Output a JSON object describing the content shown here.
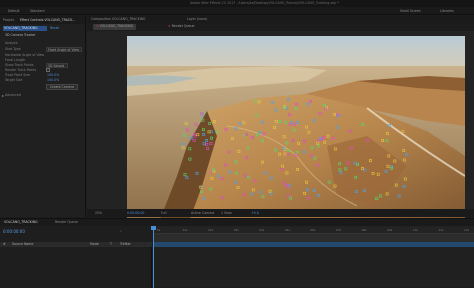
{
  "titlebar": {
    "title": "Adobe After Effects CC 2017 - /Users/ae/Desktop/VOLCANO_Tutorial/VOLCANO_Tracking.aep *"
  },
  "menubar": {
    "items": [
      "Default",
      "Standard",
      "Small Screen",
      "Libraries"
    ]
  },
  "left_panel": {
    "tabs": [
      "Project",
      "Effect Controls VOLCANO_TRACK...",
      "Tracker"
    ],
    "comp_label": "VOLCANO_TRACKING",
    "effect_name": "3D Camera Tracker",
    "reset_label": "Reset",
    "rows": [
      {
        "label": "Analyze",
        "value": ""
      },
      {
        "label": "Shot Type",
        "value": "Fixed Angle of View"
      },
      {
        "label": "Horizontal Angle of View",
        "value": ""
      },
      {
        "label": "Focal Length",
        "value": ""
      },
      {
        "label": "Show Track Points",
        "value": "3D Solved"
      },
      {
        "label": "Render Track Points",
        "value": ""
      },
      {
        "label": "Track Point Size",
        "value": "100.0%"
      },
      {
        "label": "Target Size",
        "value": "100.0%"
      }
    ],
    "create_camera_label": "Create Camera",
    "advanced_label": "Advanced"
  },
  "viewer": {
    "footage_tabs": [
      "Composition VOLCANO_TRACKING",
      "Layer (none)"
    ],
    "comp_tabs": [
      "VOLCANO_TRACKING",
      "Render Queue"
    ],
    "footer": {
      "magnification": "25%",
      "timecode": "0:00:00:00",
      "resolution": "Full",
      "camera": "Active Camera",
      "view": "1 View",
      "exposure": "+0.0"
    }
  },
  "timeline": {
    "tabs": [
      "VOLCANO_TRACKING",
      "Render Queue"
    ],
    "timecode": "0:00:00:00",
    "layer_columns": [
      "#",
      "Source Name",
      "Mode",
      "T",
      "TrkMat"
    ],
    "layer": {
      "index": "1",
      "name": "VOLCANO.mov",
      "mode": "Normal"
    },
    "ruler_ticks": [
      "0s",
      "01s",
      "02s",
      "03s",
      "04s",
      "05s",
      "06s",
      "07s",
      "08s",
      "09s",
      "10s",
      "11s",
      "12s"
    ]
  },
  "colors": {
    "accent": "#4f8fd8",
    "panel": "#202020",
    "sky": "#a6c1d4",
    "rock": "#b98a52",
    "track_points": [
      "#e24ac4",
      "#58d86a",
      "#e8c43a",
      "#4fa2e8"
    ]
  }
}
